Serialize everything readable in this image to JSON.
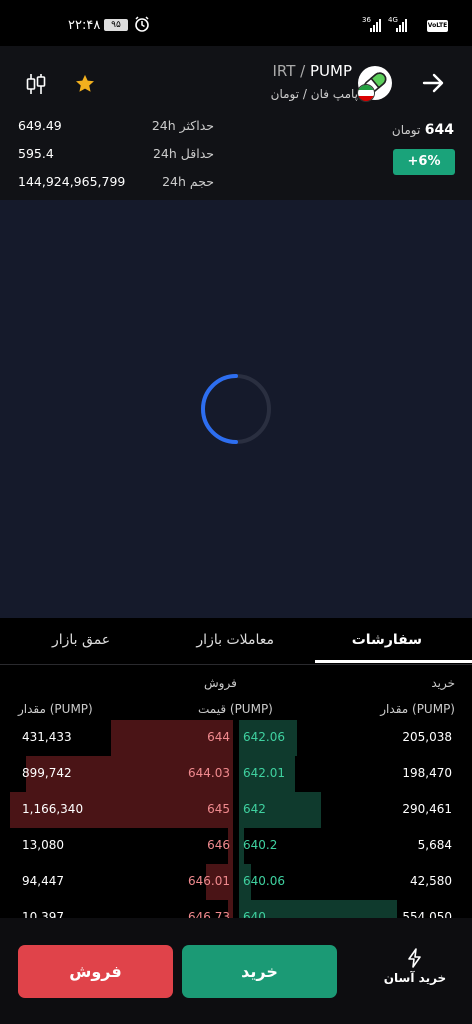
{
  "status_bar": {
    "time": "۲۲:۴۸",
    "battery": "۹۵",
    "network": "36 4G VoLTE"
  },
  "header": {
    "symbol": "PUMP",
    "quote": "IRT",
    "name_fa": "پامپ فان / تومان",
    "price_value": "644",
    "price_unit": "تومان",
    "change": "+6%",
    "stats": [
      {
        "label": "حداکثر 24h",
        "value": "649.49"
      },
      {
        "label": "حداقل 24h",
        "value": "595.4"
      },
      {
        "label": "حجم 24h",
        "value": "144,924,965,799"
      }
    ]
  },
  "tabs": {
    "orders": "سفارشات",
    "trades": "معاملات بازار",
    "depth": "عمق بازار"
  },
  "orderbook": {
    "buy_title": "خرید",
    "sell_title": "فروش",
    "col_amount_buy": "مقدار (PUMP)",
    "col_price": "قیمت (PUMP)",
    "col_amount_sell": "مقدار (PUMP)",
    "rows": [
      {
        "sell_amount": "431,433",
        "sell_price": "644",
        "buy_price": "642.06",
        "buy_amount": "205,038",
        "sell_depth": 0.54,
        "buy_depth": 0.25
      },
      {
        "sell_amount": "899,742",
        "sell_price": "644.03",
        "buy_price": "642.01",
        "buy_amount": "198,470",
        "sell_depth": 0.92,
        "buy_depth": 0.24
      },
      {
        "sell_amount": "1,166,340",
        "sell_price": "645",
        "buy_price": "642",
        "buy_amount": "290,461",
        "sell_depth": 0.99,
        "buy_depth": 0.35
      },
      {
        "sell_amount": "13,080",
        "sell_price": "646",
        "buy_price": "640.2",
        "buy_amount": "5,684",
        "sell_depth": 0.02,
        "buy_depth": 0.02
      },
      {
        "sell_amount": "94,447",
        "sell_price": "646.01",
        "buy_price": "640.06",
        "buy_amount": "42,580",
        "sell_depth": 0.12,
        "buy_depth": 0.05
      },
      {
        "sell_amount": "10,397",
        "sell_price": "646.73",
        "buy_price": "640",
        "buy_amount": "554,050",
        "sell_depth": 0.02,
        "buy_depth": 0.68
      }
    ]
  },
  "bottom": {
    "sell_label": "فروش",
    "buy_label": "خرید",
    "easy_buy_label": "خرید آسان"
  },
  "colors": {
    "buy": "#1b9a75",
    "sell": "#e0434a",
    "chart_bg": "#151a2b",
    "star": "#f2b01e"
  }
}
